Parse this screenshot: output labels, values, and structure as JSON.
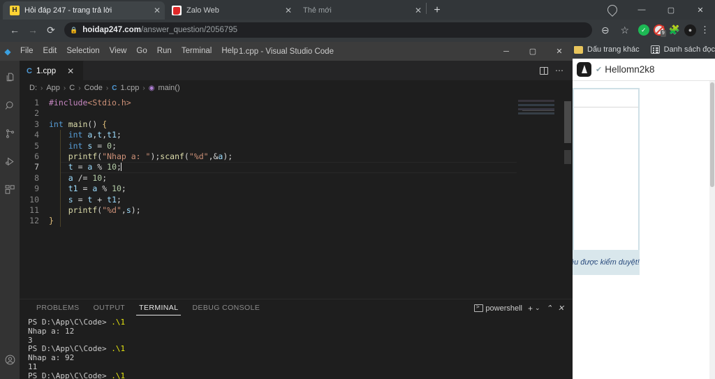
{
  "browser": {
    "tabs": [
      {
        "title": "Hỏi đáp 247 - trang trả lời",
        "favicon": "hoidap-favicon",
        "active": true,
        "close_label": "✕"
      },
      {
        "title": "Zalo Web",
        "favicon": "zalo-favicon",
        "active": false,
        "close_label": "✕"
      },
      {
        "title": "Thẻ mới",
        "favicon": "none",
        "active": false,
        "close_label": "✕"
      }
    ],
    "new_tab_label": "+",
    "window_controls": {
      "minimize": "—",
      "maximize": "▢",
      "close": "✕"
    },
    "nav": {
      "back": "←",
      "forward": "→",
      "reload": "⟳"
    },
    "omnibox": {
      "lock": "🔒",
      "url_domain": "hoidap247.com",
      "url_path": "/answer_question/2056795",
      "zoom_icon": "⊖",
      "bookmark_icon": "☆"
    },
    "extensions": [
      {
        "name": "adblock-check-icon",
        "label": "✓"
      },
      {
        "name": "blocker-icon",
        "badge": "9"
      },
      {
        "name": "extensions-puzzle-icon",
        "label": "🧩"
      },
      {
        "name": "profile-avatar-icon",
        "label": "•"
      },
      {
        "name": "chrome-menu-icon",
        "label": "⋮"
      }
    ],
    "bookmarks": [
      {
        "label": "Dấu trang khác",
        "icon": "folder-icon"
      },
      {
        "label": "Danh sách đọc",
        "icon": "reading-list-icon"
      }
    ]
  },
  "page": {
    "username": "Hellomn2k8",
    "verified_icon": "✔",
    "note_text": "ệu được kiểm duyệt!"
  },
  "vscode": {
    "title": "1.cpp - Visual Studio Code",
    "menu": [
      "File",
      "Edit",
      "Selection",
      "View",
      "Go",
      "Run",
      "Terminal",
      "Help"
    ],
    "window_controls": {
      "minimize": "─",
      "maximize": "▢",
      "close": "✕"
    },
    "activity_bar": [
      "explorer-icon",
      "search-icon",
      "source-control-icon",
      "run-and-debug-icon",
      "extensions-icon",
      "accounts-icon"
    ],
    "tab": {
      "label": "1.cpp",
      "icon": "cpp-file-icon",
      "close": "✕"
    },
    "tab_actions": {
      "split_editor": "split-editor-icon",
      "more": "⋯"
    },
    "breadcrumb": [
      "D:",
      "App",
      "C",
      "Code",
      "1.cpp",
      "main()"
    ],
    "breadcrumb_sep": "›",
    "code_lines": [
      {
        "n": "1",
        "tokens": [
          {
            "t": "#include",
            "c": "pre"
          },
          {
            "t": "<Stdio.h>",
            "c": "inc"
          }
        ],
        "indent": 0
      },
      {
        "n": "2",
        "tokens": [],
        "indent": 0
      },
      {
        "n": "3",
        "tokens": [
          {
            "t": "int ",
            "c": "k"
          },
          {
            "t": "main",
            "c": "fn"
          },
          {
            "t": "() ",
            "c": "pun"
          },
          {
            "t": "{",
            "c": "brk"
          }
        ],
        "indent": 0
      },
      {
        "n": "4",
        "tokens": [
          {
            "t": "int ",
            "c": "k"
          },
          {
            "t": "a",
            "c": "var"
          },
          {
            "t": ",",
            "c": "pun"
          },
          {
            "t": "t",
            "c": "var"
          },
          {
            "t": ",",
            "c": "pun"
          },
          {
            "t": "t1",
            "c": "var"
          },
          {
            "t": ";",
            "c": "pun"
          }
        ],
        "indent": 1
      },
      {
        "n": "5",
        "tokens": [
          {
            "t": "int ",
            "c": "k"
          },
          {
            "t": "s",
            "c": "var"
          },
          {
            "t": " = ",
            "c": "op"
          },
          {
            "t": "0",
            "c": "num"
          },
          {
            "t": ";",
            "c": "pun"
          }
        ],
        "indent": 1
      },
      {
        "n": "6",
        "tokens": [
          {
            "t": "printf",
            "c": "fn"
          },
          {
            "t": "(",
            "c": "pun"
          },
          {
            "t": "\"Nhap a: \"",
            "c": "str"
          },
          {
            "t": ");",
            "c": "pun"
          },
          {
            "t": "scanf",
            "c": "fn"
          },
          {
            "t": "(",
            "c": "pun"
          },
          {
            "t": "\"%d\"",
            "c": "str"
          },
          {
            "t": ",&",
            "c": "pun"
          },
          {
            "t": "a",
            "c": "var"
          },
          {
            "t": ");",
            "c": "pun"
          }
        ],
        "indent": 1
      },
      {
        "n": "7",
        "tokens": [
          {
            "t": "t",
            "c": "var"
          },
          {
            "t": " = ",
            "c": "op"
          },
          {
            "t": "a",
            "c": "var"
          },
          {
            "t": " % ",
            "c": "op"
          },
          {
            "t": "10",
            "c": "num"
          },
          {
            "t": ";",
            "c": "pun"
          }
        ],
        "indent": 1,
        "active": true,
        "caret": true
      },
      {
        "n": "8",
        "tokens": [
          {
            "t": "a",
            "c": "var"
          },
          {
            "t": " /= ",
            "c": "op"
          },
          {
            "t": "10",
            "c": "num"
          },
          {
            "t": ";",
            "c": "pun"
          }
        ],
        "indent": 1
      },
      {
        "n": "9",
        "tokens": [
          {
            "t": "t1",
            "c": "var"
          },
          {
            "t": " = ",
            "c": "op"
          },
          {
            "t": "a",
            "c": "var"
          },
          {
            "t": " % ",
            "c": "op"
          },
          {
            "t": "10",
            "c": "num"
          },
          {
            "t": ";",
            "c": "pun"
          }
        ],
        "indent": 1
      },
      {
        "n": "10",
        "tokens": [
          {
            "t": "s",
            "c": "var"
          },
          {
            "t": " = ",
            "c": "op"
          },
          {
            "t": "t",
            "c": "var"
          },
          {
            "t": " + ",
            "c": "op"
          },
          {
            "t": "t1",
            "c": "var"
          },
          {
            "t": ";",
            "c": "pun"
          }
        ],
        "indent": 1
      },
      {
        "n": "11",
        "tokens": [
          {
            "t": "printf",
            "c": "fn"
          },
          {
            "t": "(",
            "c": "pun"
          },
          {
            "t": "\"%d\"",
            "c": "str"
          },
          {
            "t": ",",
            "c": "pun"
          },
          {
            "t": "s",
            "c": "var"
          },
          {
            "t": ");",
            "c": "pun"
          }
        ],
        "indent": 1
      },
      {
        "n": "12",
        "tokens": [
          {
            "t": "}",
            "c": "brk"
          }
        ],
        "indent": 0
      }
    ],
    "panel": {
      "tabs": [
        {
          "label": "PROBLEMS",
          "active": false
        },
        {
          "label": "OUTPUT",
          "active": false
        },
        {
          "label": "TERMINAL",
          "active": true
        },
        {
          "label": "DEBUG CONSOLE",
          "active": false
        }
      ],
      "shell_name": "powershell",
      "actions": {
        "new": "+",
        "dropdown": "⌄",
        "split_up": "⌃",
        "close": "✕"
      },
      "terminal_lines": [
        [
          {
            "t": "PS D:\\App\\C\\Code> ",
            "c": ""
          },
          {
            "t": ".\\1",
            "c": "tyellow"
          }
        ],
        [
          {
            "t": "Nhap a: 12",
            "c": ""
          }
        ],
        [
          {
            "t": "3",
            "c": ""
          }
        ],
        [
          {
            "t": "PS D:\\App\\C\\Code> ",
            "c": ""
          },
          {
            "t": ".\\1",
            "c": "tyellow"
          }
        ],
        [
          {
            "t": "Nhap a: 92",
            "c": ""
          }
        ],
        [
          {
            "t": "11",
            "c": ""
          }
        ],
        [
          {
            "t": "PS D:\\App\\C\\Code> ",
            "c": ""
          },
          {
            "t": ".\\1",
            "c": "tyellow"
          }
        ]
      ]
    }
  }
}
